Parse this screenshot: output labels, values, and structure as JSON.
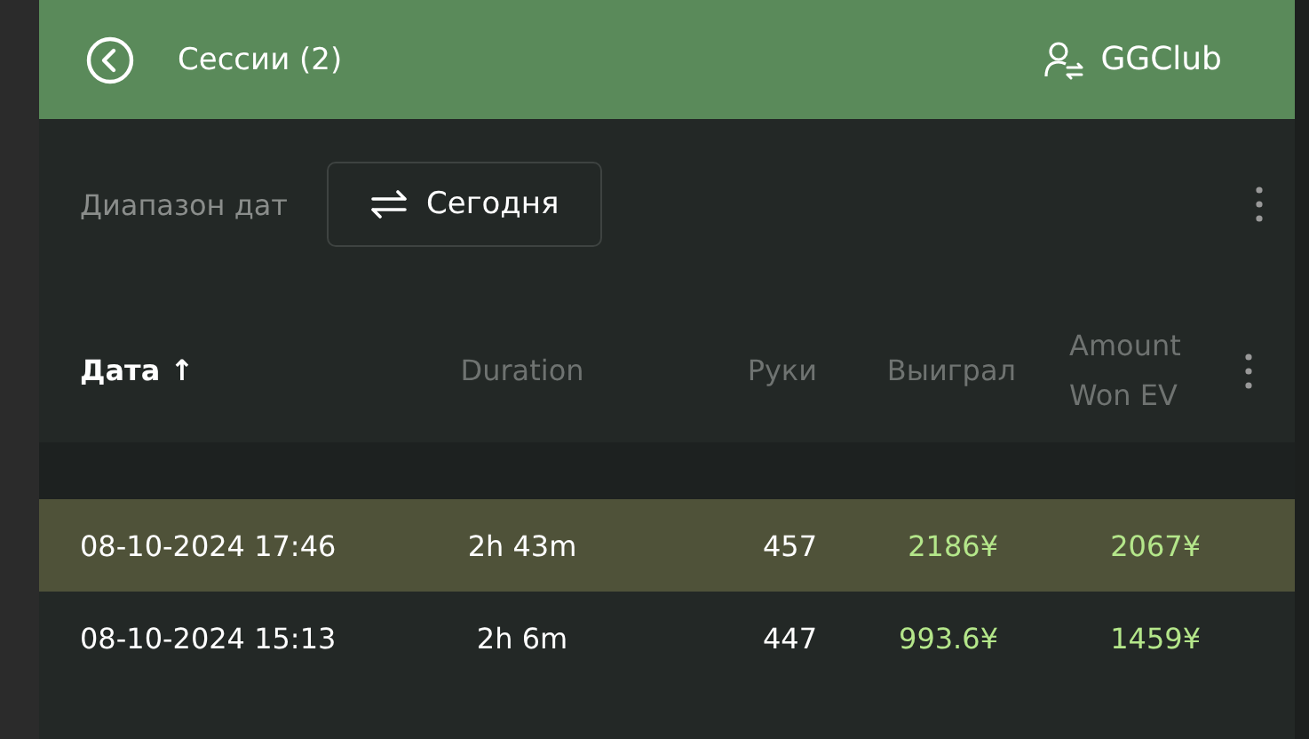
{
  "header": {
    "title": "Сессии (2)",
    "account": "GGClub"
  },
  "filter": {
    "label": "Диапазон дат",
    "value": "Сегодня"
  },
  "table": {
    "columns": [
      {
        "label": "Дата",
        "sorted": true,
        "sort_indicator": "↑"
      },
      {
        "label": "Duration",
        "sorted": false
      },
      {
        "label": "Руки",
        "sorted": false
      },
      {
        "label": "Выиграл",
        "sorted": false
      },
      {
        "label": "Amount Won EV",
        "sorted": false
      }
    ],
    "rows": [
      {
        "selected": true,
        "cells": [
          "08-10-2024 17:46",
          "2h 43m",
          "457",
          "2186¥",
          "2067¥"
        ]
      },
      {
        "selected": false,
        "cells": [
          "08-10-2024 15:13",
          "2h 6m",
          "447",
          "993.6¥",
          "1459¥"
        ]
      }
    ]
  }
}
